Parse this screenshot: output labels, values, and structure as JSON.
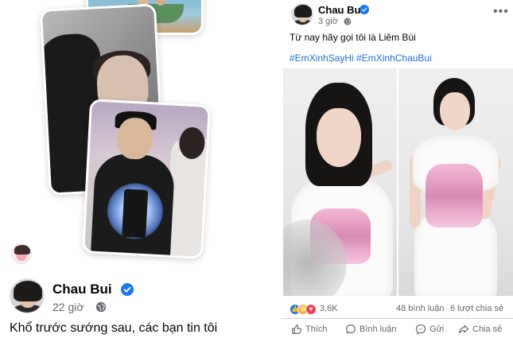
{
  "left_post": {
    "author": "Chau Bui",
    "time": "22 giờ",
    "caption": "Khổ trước sướng sau, các bạn tin tôi"
  },
  "right_post": {
    "author": "Chau Bui",
    "time": "3 giờ",
    "caption": "Từ nay hãy gọi tôi là Liêm Bùi",
    "hashtags": [
      "#EmXinhSayHi",
      "#EmXinhChauBui"
    ],
    "reaction_count": "3,6K",
    "comments": "48 bình luận",
    "shares": "6 lượt chia sẻ",
    "actions": {
      "like": "Thích",
      "comment": "Bình luận",
      "send": "Gửi",
      "share": "Chia sẻ"
    }
  },
  "icons": {
    "verified": "verified-badge-icon",
    "audience": "globe-icon",
    "more": "more-options-icon"
  },
  "colors": {
    "link": "#216fdb",
    "verified": "#1877f2",
    "secondary_text": "#65676b",
    "like_reaction": "#1877f2",
    "haha_reaction": "#f7b125",
    "love_reaction": "#f33e58"
  }
}
